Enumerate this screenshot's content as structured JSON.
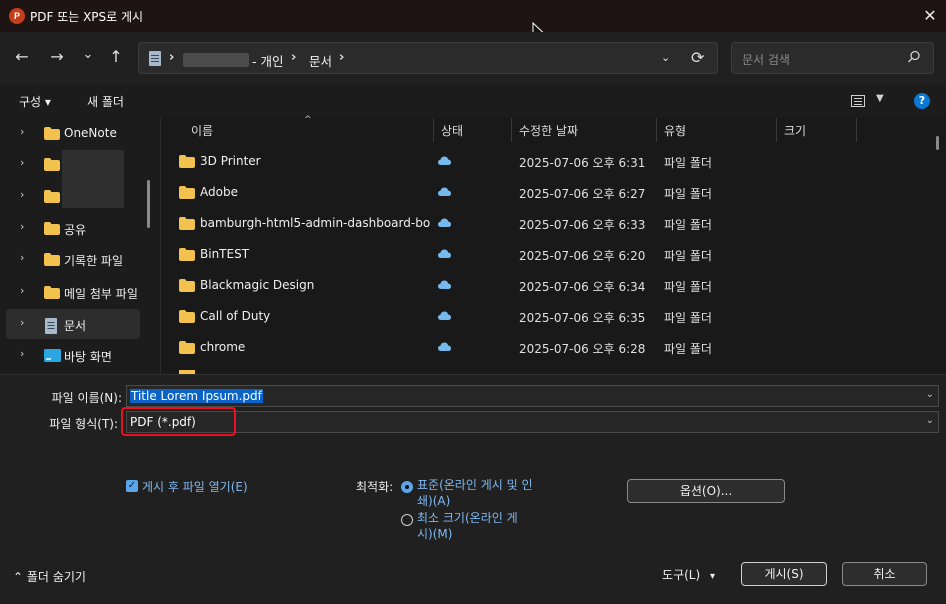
{
  "window": {
    "title": "PDF 또는 XPS로 게시",
    "app_icon_letter": "P",
    "close_glyph": "✕"
  },
  "nav": {
    "back": "←",
    "forward": "→",
    "recent": "⌄",
    "up": "↑",
    "breadcrumb": {
      "segment_owner": "- 개인",
      "segment_folder": "문서"
    },
    "search_placeholder": "문서 검색"
  },
  "commands": {
    "organize": "구성 ▾",
    "new_folder": "새 폴더",
    "help": "?"
  },
  "sidebar": {
    "items": [
      {
        "label": "OneNote",
        "icon": "folder-icon"
      },
      {
        "label": "",
        "icon": "folder-icon"
      },
      {
        "label": "",
        "icon": "folder-icon"
      },
      {
        "label": "공유",
        "icon": "folder-icon"
      },
      {
        "label": "기록한 파일",
        "icon": "folder-icon"
      },
      {
        "label": "메일 첨부 파일",
        "icon": "folder-icon"
      },
      {
        "label": "문서",
        "icon": "documents-icon",
        "selected": true
      },
      {
        "label": "바탕 화면",
        "icon": "desktop-icon"
      }
    ]
  },
  "file_list": {
    "columns": [
      "이름",
      "상태",
      "수정한 날짜",
      "유형",
      "크기"
    ],
    "rows": [
      {
        "name": "3D Printer",
        "status": "cloud",
        "date": "2025-07-06 오후 6:31",
        "type": "파일 폴더"
      },
      {
        "name": "Adobe",
        "status": "cloud",
        "date": "2025-07-06 오후 6:27",
        "type": "파일 폴더"
      },
      {
        "name": "bamburgh-html5-admin-dashboard-bo...",
        "status": "cloud",
        "date": "2025-07-06 오후 6:33",
        "type": "파일 폴더"
      },
      {
        "name": "BinTEST",
        "status": "cloud",
        "date": "2025-07-06 오후 6:20",
        "type": "파일 폴더"
      },
      {
        "name": "Blackmagic Design",
        "status": "cloud",
        "date": "2025-07-06 오후 6:34",
        "type": "파일 폴더"
      },
      {
        "name": "Call of Duty",
        "status": "cloud",
        "date": "2025-07-06 오후 6:35",
        "type": "파일 폴더"
      },
      {
        "name": "chrome",
        "status": "cloud",
        "date": "2025-07-06 오후 6:28",
        "type": "파일 폴더"
      }
    ]
  },
  "form": {
    "filename_label": "파일 이름(N):",
    "filename_value": "Title Lorem Ipsum.pdf",
    "filetype_label": "파일 형식(T):",
    "filetype_value": "PDF (*.pdf)",
    "open_after_label": "게시 후 파일 열기(E)",
    "open_after_checked": true,
    "optimize_label": "최적화:",
    "optimize_standard": "표준(온라인 게시 및 인쇄)(A)",
    "optimize_minimum": "최소 크기(온라인 게시)(M)",
    "options_button": "옵션(O)..."
  },
  "footer": {
    "hide_folders": "폴더 숨기기",
    "tools": "도구(L)",
    "publish": "게시(S)",
    "cancel": "취소"
  },
  "colors": {
    "accent": "#0a64c8",
    "link_blue": "#7fb8f0",
    "highlight_red": "#e81123",
    "folder_yellow": "#f2c14e"
  }
}
